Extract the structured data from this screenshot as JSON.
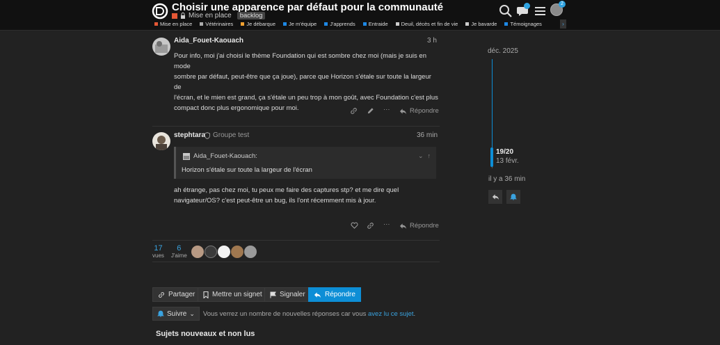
{
  "header": {
    "title": "Choisir une apparence par défaut pour la communauté",
    "category": "Mise en place",
    "tag": "backlog",
    "notification_count": "2",
    "categories": [
      {
        "label": "Mise en place",
        "color": "#e45735"
      },
      {
        "label": "Vétérinaires",
        "color": "#aaaaaa"
      },
      {
        "label": "Je débarque",
        "color": "#f0a030"
      },
      {
        "label": "Je m'équipe",
        "color": "#1e88e5"
      },
      {
        "label": "J'apprends",
        "color": "#1e88e5"
      },
      {
        "label": "Entraide",
        "color": "#1e88e5"
      },
      {
        "label": "Deuil, décès et fin de vie",
        "color": "#cccccc"
      },
      {
        "label": "Je bavarde",
        "color": "#cccccc"
      },
      {
        "label": "Témoignages",
        "color": "#1e88e5"
      }
    ]
  },
  "posts": [
    {
      "username": "Aida_Fouet-Kaouach",
      "time": "3 h",
      "lines": [
        "Pour info, moi j'ai choisi le thème Foundation qui est sombre chez moi (mais je suis en mode",
        "sombre par défaut, peut-être que ça joue), parce que Horizon s'étale sur toute la largeur de",
        "l'écran, et le mien est grand, ça s'étale un peu trop à mon goût, avec Foundation c'est plus",
        "compact donc plus ergonomique pour moi."
      ],
      "reply_label": "Répondre"
    },
    {
      "username": "stephtara",
      "group": "Groupe test",
      "time": "36 min",
      "quote_author": "Aida_Fouet-Kaouach:",
      "quote_text": "Horizon s'étale sur toute la largeur de l'écran",
      "lines": [
        "ah étrange, pas chez moi, tu peux me faire des captures stp? et me dire quel",
        "navigateur/OS? c'est peut-être un bug, ils l'ont récemment mis à jour."
      ],
      "reply_label": "Répondre"
    }
  ],
  "stats": {
    "views": "17",
    "views_label": "vues",
    "likes": "6",
    "likes_label": "J'aime"
  },
  "footer": {
    "share": "Partager",
    "bookmark": "Mettre un signet",
    "flag": "Signaler",
    "reply": "Répondre",
    "notify": "Suivre",
    "notify_text": "Vous verrez un nombre de nouvelles réponses car vous",
    "notify_link": "avez lu ce sujet",
    "notify_end": ".",
    "section_title": "Sujets nouveaux et non lus"
  },
  "timeline": {
    "start": "déc. 2025",
    "position": "19/20",
    "position_date": "13 févr.",
    "ago": "il y a 36 min"
  },
  "colors": {
    "accent": "#0d8ed6",
    "header_bg": "#111111",
    "page_bg": "#222222"
  }
}
